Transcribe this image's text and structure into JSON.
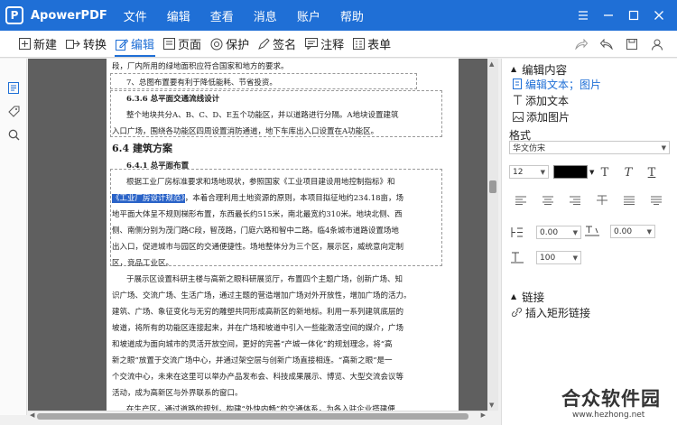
{
  "app": {
    "logo_letter": "P",
    "name": "ApowerPDF"
  },
  "menu": [
    "文件",
    "编辑",
    "查看",
    "消息",
    "账户",
    "帮助"
  ],
  "toolbar": {
    "items": [
      {
        "label": "新建",
        "icon": "plus-square-icon"
      },
      {
        "label": "转换",
        "icon": "convert-icon"
      },
      {
        "label": "编辑",
        "icon": "edit-icon",
        "active": true
      },
      {
        "label": "页面",
        "icon": "page-icon"
      },
      {
        "label": "保护",
        "icon": "protect-icon"
      },
      {
        "label": "签名",
        "icon": "pen-icon"
      },
      {
        "label": "注释",
        "icon": "comment-icon"
      },
      {
        "label": "表单",
        "icon": "form-icon"
      }
    ]
  },
  "document": {
    "lines": [
      "段，厂内所用的绿地面积应符合国家和地方的要求。",
      "7、总图布置要有利于降低能耗、节省投资。",
      "6.3.6 总平面交通流线设计",
      "整个地块共分A、B、C、D、E五个功能区，并以道路进行分隔。A地块设置建筑",
      "入口广场，围绕各功能区四周设置消防通道，地下车库出入口设置在A功能区。",
      "6.4 建筑方案",
      "6.4.1 总平面布置",
      "根据工业厂房标准要求和场地现状，参照国家《工业项目建设用地控制指标》和",
      "《工业厂房设计规范》",
      "，本着合理利用土地资源的原则，本项目拟征地约234.18亩，场",
      "地平面大体呈不规则梯形布置，东西最长约515米，南北最宽约310米。地块北侧、西",
      "侧、南侧分别为茂门路C段，智茂路，门庭六路和智中二路。临4条城市道路设置场地",
      "出入口，促进城市与园区的交通便捷性。场地整体分为三个区，展示区，威统意向定制",
      "区，竞品工业区。",
      "于展示区设置科研主楼与高新之眼科研展览厅，布置四个主题广场，创新广场、知",
      "识广场、交流广场、生活广场，通过主题的营造增加广场对外开放性，增加广场的活力。",
      "建筑、广场、象征变化与无穷的雕塑共同形成高新区的新地标。利用一系列建筑底层的",
      "坡道，将所有的功能区连接起来，并在广场和坡道中引入一些能激活空间的媒介，广场",
      "和坡道成为面向城市的灵活开放空间，更好的完善“产城一体化”的规划理念，将“高",
      "新之眼”放置于交流广场中心，并通过架空层与创新广场直接相连。“高新之眼”是一",
      "个交流中心，未来在这里可以举办产品发布会、科技成果展示、博览、大型交流会议等",
      "活动，成为高新区与外界联系的窗口。",
      "在生产区，通过道路的规划，构建“外快内畅”的交通体系，为各入驻企业搭建便"
    ]
  },
  "panel": {
    "section_edit": "编辑内容",
    "edit_items": [
      {
        "label": "编辑文本；图片",
        "icon": "edit-text-image-icon",
        "active": true
      },
      {
        "label": "添加文本",
        "icon": "add-text-icon"
      },
      {
        "label": "添加图片",
        "icon": "add-image-icon"
      }
    ],
    "format_label": "格式",
    "font_family": "华文仿宋",
    "font_size": "12",
    "text_color": "#000000",
    "line_spacing": "0.00",
    "char_spacing": "0.00",
    "scale": "100",
    "section_link": "链接",
    "link_item": "插入矩形链接"
  },
  "watermark": {
    "title": "合众软件园",
    "url": "www.hezhong.net"
  }
}
